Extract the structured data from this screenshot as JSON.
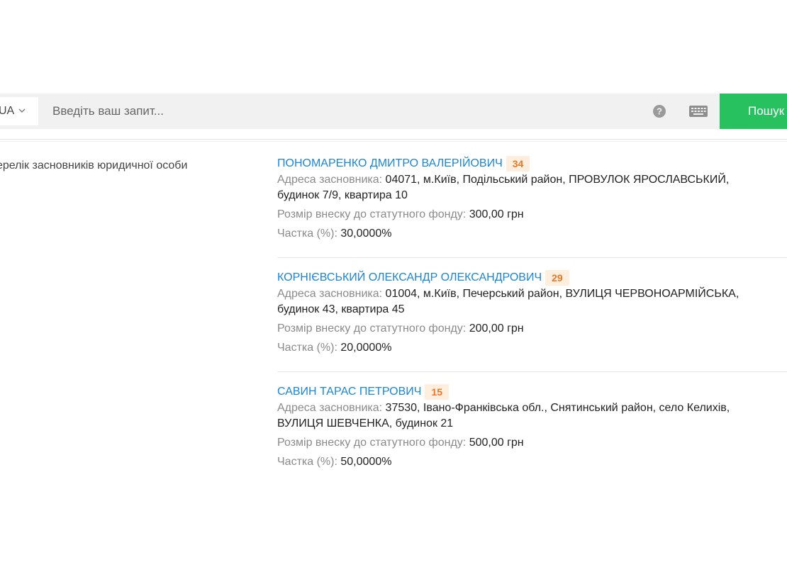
{
  "search": {
    "language": "UA",
    "placeholder": "Введіть ваш запит...",
    "button_label": "Пошук",
    "icons": [
      "chevron-down-icon",
      "help-icon",
      "keyboard-icon"
    ],
    "button_color": "#27c160"
  },
  "section": {
    "label": "ерелік засновників юридичної особи"
  },
  "labels": {
    "address": "Адреса засновника:",
    "contribution": "Розмір внеску до статутного фонду:",
    "share": "Частка (%):"
  },
  "founders": [
    {
      "name": "ПОНОМАРЕНКО ДМИТРО ВАЛЕРІЙОВИЧ",
      "badge": "34",
      "address_line1": "04071, м.Київ, Подільський район, ПРОВУЛОК ЯРОСЛАВСЬКИЙ,",
      "address_line2": "будинок 7/9, квартира 10",
      "contribution": "300,00 грн",
      "share": "30,0000%"
    },
    {
      "name": "КОРНІЄВСЬКИЙ ОЛЕКСАНДР ОЛЕКСАНДРОВИЧ",
      "badge": "29",
      "address_line1": "01004, м.Київ, Печерський район, ВУЛИЦЯ ЧЕРВОНОАРМІЙСЬКА,",
      "address_line2": "будинок 43, квартира 45",
      "contribution": "200,00 грн",
      "share": "20,0000%"
    },
    {
      "name": "САВИН ТАРАС ПЕТРОВИЧ",
      "badge": "15",
      "address_line1": "37530, Івано-Франківська обл., Снятинський район, село Келихів,",
      "address_line2": "ВУЛИЦЯ ШЕВЧЕНКА, будинок 21",
      "contribution": "500,00 грн",
      "share": "50,0000%"
    }
  ]
}
